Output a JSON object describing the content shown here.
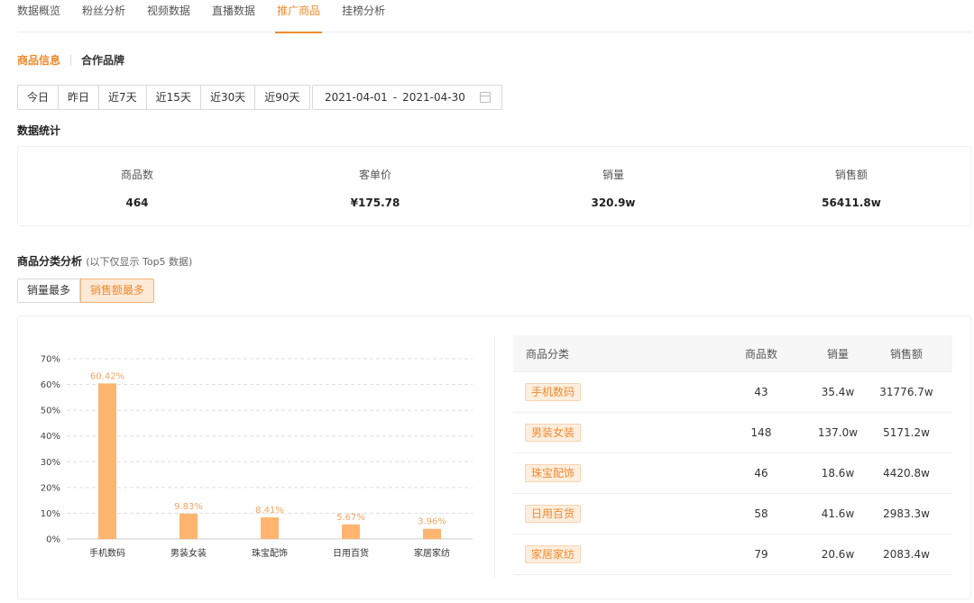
{
  "tabs": [
    {
      "label": "数据概览",
      "active": false
    },
    {
      "label": "粉丝分析",
      "active": false
    },
    {
      "label": "视频数据",
      "active": false
    },
    {
      "label": "直播数据",
      "active": false
    },
    {
      "label": "推广商品",
      "active": true
    },
    {
      "label": "挂榜分析",
      "active": false
    }
  ],
  "subnav": {
    "items": [
      "商品信息",
      "合作品牌"
    ],
    "active_index": 0
  },
  "date_range": {
    "buttons": [
      "今日",
      "昨日",
      "近7天",
      "近15天",
      "近30天",
      "近90天"
    ],
    "start": "2021-04-01",
    "separator": "-",
    "end": "2021-04-30"
  },
  "stats_title": "数据统计",
  "stats": [
    {
      "label": "商品数",
      "value": "464"
    },
    {
      "label": "客单价",
      "value": "¥175.78"
    },
    {
      "label": "销量",
      "value": "320.9w"
    },
    {
      "label": "销售额",
      "value": "56411.8w"
    }
  ],
  "analysis": {
    "title": "商品分类分析",
    "note": "(以下仅显示 Top5 数据)",
    "toggle": [
      "销量最多",
      "销售额最多"
    ],
    "active_toggle": 1
  },
  "chart_data": {
    "type": "bar",
    "categories": [
      "手机数码",
      "男装女装",
      "珠宝配饰",
      "日用百货",
      "家居家纺"
    ],
    "values": [
      60.42,
      9.83,
      8.41,
      5.67,
      3.96
    ],
    "value_labels": [
      "60.42%",
      "9.83%",
      "8.41%",
      "5.67%",
      "3.96%"
    ],
    "yticks": [
      "0%",
      "10%",
      "20%",
      "30%",
      "40%",
      "50%",
      "60%",
      "70%"
    ],
    "ylim": [
      0,
      70
    ],
    "grid": true,
    "bar_color": "#ffb570",
    "label_color": "#f4a660"
  },
  "table": {
    "headers": [
      "商品分类",
      "商品数",
      "销量",
      "销售额"
    ],
    "rows": [
      {
        "category": "手机数码",
        "count": "43",
        "sales": "35.4w",
        "revenue": "31776.7w"
      },
      {
        "category": "男装女装",
        "count": "148",
        "sales": "137.0w",
        "revenue": "5171.2w"
      },
      {
        "category": "珠宝配饰",
        "count": "46",
        "sales": "18.6w",
        "revenue": "4420.8w"
      },
      {
        "category": "日用百货",
        "count": "58",
        "sales": "41.6w",
        "revenue": "2983.3w"
      },
      {
        "category": "家居家纺",
        "count": "79",
        "sales": "20.6w",
        "revenue": "2083.4w"
      }
    ]
  },
  "colors": {
    "accent": "#f08a2e"
  }
}
